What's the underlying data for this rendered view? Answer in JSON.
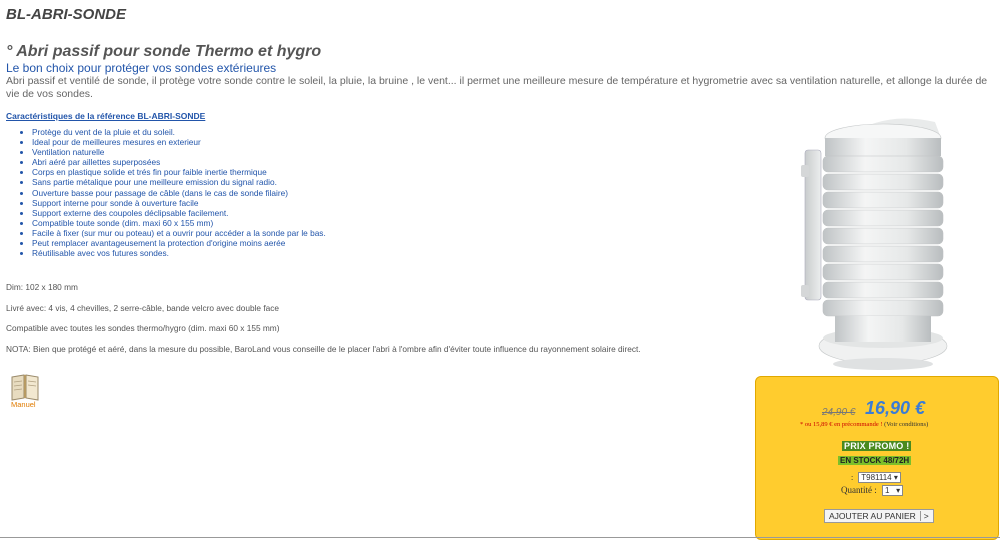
{
  "product": {
    "code": "BL-ABRI-SONDE",
    "headline": "° Abri passif pour sonde Thermo et hygro",
    "subheadline": "Le bon choix pour protéger vos sondes extérieures",
    "intro": "Abri passif et ventilé de sonde, il protège votre sonde contre le soleil, la pluie, la bruine , le vent... il permet une meilleure mesure de température et hygrometrie avec sa ventilation naturelle, et allonge la durée de vie de vos sondes."
  },
  "characteristics": {
    "title": "Caractéristiques de la référence BL-ABRI-SONDE",
    "items": [
      "Protège du vent de la pluie et du soleil.",
      "Ideal pour de meilleures mesures en exterieur",
      "Ventilation naturelle",
      "Abri aéré par aillettes superposées",
      "Corps en plastique solide et trés fin pour faible inertie thermique",
      "Sans partie métalique pour une meilleure emission du signal radio.",
      "Ouverture basse pour passage de câble (dans le cas de sonde filaire)",
      "Support interne pour sonde à ouverture facile",
      "Support externe des coupoles déclipsable facilement.",
      "Compatible toute sonde (dim. maxi 60 x 155 mm)",
      "Facile à fixer (sur mur ou poteau) et a ouvrir pour accéder a la sonde par le bas.",
      "Peut remplacer avantageusement la protection d'origine moins aerée",
      "Réutilisable avec vos futures sondes."
    ]
  },
  "notes": {
    "dimensions": "Dim: 102 x 180 mm",
    "delivered": "Livré avec: 4 vis, 4 chevilles, 2 serre-câble, bande velcro avec double face",
    "compatible": "Compatible avec toutes les sondes thermo/hygro (dim. maxi 60 x 155 mm)",
    "warning": "NOTA: Bien que protégé et aéré, dans la mesure du possible, BaroLand vous conseille de le placer l'abri à l'ombre afin d'éviter toute influence du rayonnement solaire direct."
  },
  "manual": {
    "label": "Manuel",
    "icon": "book-icon"
  },
  "pricing": {
    "old_price": "24,90 €",
    "new_price": "16,90 €",
    "promo_prefix": "* ou 15,89 €",
    "promo_suffix": "en précommande !",
    "conditions": "(Voir conditions)",
    "promo_flag": "PRIX PROMO !",
    "stock_flag": "EN STOCK 48/72H",
    "ref_label": ":",
    "ref_value": "T981114",
    "qty_label": "Quantité :",
    "qty_value": "1",
    "cart_button": "AJOUTER AU PANIER",
    "cart_arrow": ">",
    "accent": "#3a7cd6",
    "box_color": "#ffcc2e"
  }
}
